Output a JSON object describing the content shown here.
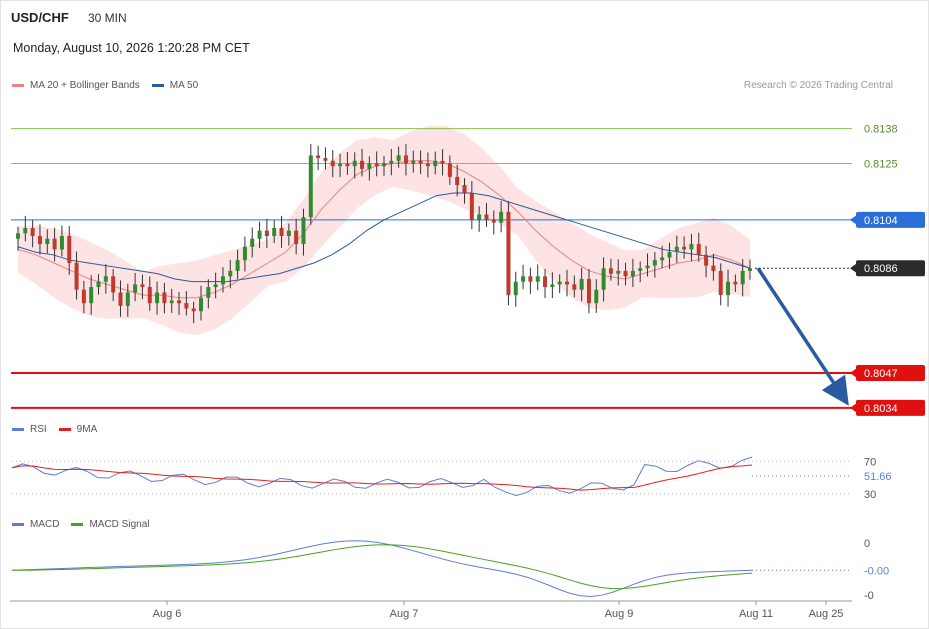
{
  "header": {
    "symbol": "USD/CHF",
    "timeframe": "30 MIN",
    "datetime": "Monday, August 10, 2026 1:20:28 PM CET"
  },
  "credit": "Research © 2026 Trading Central",
  "legends": {
    "main": [
      {
        "label": "MA 20 + Bollinger Bands",
        "color": "#f08080"
      },
      {
        "label": "MA 50",
        "color": "#2c5aa0"
      }
    ],
    "rsi": [
      {
        "label": "RSI",
        "color": "#5b7fd6"
      },
      {
        "label": "9MA",
        "color": "#e02020"
      }
    ],
    "macd": [
      {
        "label": "MACD",
        "color": "#5b7fd6"
      },
      {
        "label": "MACD Signal",
        "color": "#4aa020"
      }
    ]
  },
  "levels": [
    {
      "label": "0.8138",
      "value": 0.8138,
      "kind": "target",
      "color": "#8cc04a"
    },
    {
      "label": "0.8125",
      "value": 0.8125,
      "kind": "target",
      "color": "#8cc04a"
    },
    {
      "label": "0.8104",
      "value": 0.8104,
      "kind": "pivot",
      "color": "#2a6fd8"
    },
    {
      "label": "0.8086",
      "value": 0.8086,
      "kind": "last",
      "color": "#2b2b2b"
    },
    {
      "label": "0.8047",
      "value": 0.8047,
      "kind": "support",
      "color": "#e01010"
    },
    {
      "label": "0.8034",
      "value": 0.8034,
      "kind": "support",
      "color": "#e01010"
    }
  ],
  "x_labels": [
    "Aug 6",
    "Aug 7",
    "Aug 9",
    "Aug 11",
    "Aug 25"
  ],
  "rsi": {
    "ticks": [
      "70",
      "30"
    ],
    "current_label": "51.66",
    "current": 51.66
  },
  "macd": {
    "ticks": [
      "0",
      "-0"
    ],
    "current_label": "-0.00"
  },
  "chart_data": {
    "type": "candlestick",
    "price_range": [
      0.80295,
      0.81505
    ],
    "close_series": [
      0.8099,
      0.8101,
      0.8098,
      0.8095,
      0.8097,
      0.8093,
      0.8098,
      0.8088,
      0.8078,
      0.8073,
      0.8079,
      0.8081,
      0.8083,
      0.8077,
      0.8072,
      0.8077,
      0.808,
      0.8079,
      0.8073,
      0.8077,
      0.8073,
      0.8074,
      0.8073,
      0.8071,
      0.807,
      0.8075,
      0.8079,
      0.808,
      0.8083,
      0.8085,
      0.8089,
      0.8094,
      0.8097,
      0.81,
      0.8098,
      0.8101,
      0.8098,
      0.81,
      0.8095,
      0.8105,
      0.8128,
      0.8127,
      0.8126,
      0.8124,
      0.8125,
      0.8124,
      0.8126,
      0.8123,
      0.8125,
      0.8124,
      0.8125,
      0.8126,
      0.8128,
      0.8125,
      0.8126,
      0.8125,
      0.8124,
      0.8126,
      0.8125,
      0.812,
      0.8117,
      0.8114,
      0.8104,
      0.8106,
      0.8104,
      0.8103,
      0.8107,
      0.8076,
      0.8081,
      0.8083,
      0.8081,
      0.8083,
      0.8079,
      0.808,
      0.8081,
      0.808,
      0.8078,
      0.8082,
      0.8073,
      0.8078,
      0.8086,
      0.8084,
      0.8085,
      0.8083,
      0.8085,
      0.8086,
      0.8087,
      0.8089,
      0.809,
      0.8092,
      0.8094,
      0.8093,
      0.8095,
      0.8091,
      0.8087,
      0.8085,
      0.8076,
      0.8081,
      0.808,
      0.8085,
      0.8086
    ],
    "ma20": [
      0.8093,
      0.8091,
      0.8088,
      0.8085,
      0.8082,
      0.808,
      0.8078,
      0.8076,
      0.8076,
      0.8075,
      0.8075,
      0.8077,
      0.808,
      0.8084,
      0.8088,
      0.8092,
      0.8099,
      0.8108,
      0.8115,
      0.8121,
      0.8124,
      0.8125,
      0.8126,
      0.8126,
      0.8125,
      0.8122,
      0.8118,
      0.8113,
      0.8107,
      0.81,
      0.8094,
      0.8089,
      0.8085,
      0.8083,
      0.8082,
      0.8084,
      0.8086,
      0.8088,
      0.8089,
      0.8091,
      0.8089,
      0.8086
    ],
    "ma50": [
      0.8094,
      0.8092,
      0.8091,
      0.8089,
      0.8088,
      0.8087,
      0.8086,
      0.8085,
      0.8084,
      0.8082,
      0.8081,
      0.8081,
      0.8081,
      0.8082,
      0.8083,
      0.8084,
      0.8086,
      0.8088,
      0.8091,
      0.8095,
      0.81,
      0.8104,
      0.8107,
      0.811,
      0.8113,
      0.8114,
      0.8114,
      0.8113,
      0.8111,
      0.8109,
      0.8107,
      0.8105,
      0.8103,
      0.8101,
      0.8099,
      0.8097,
      0.8095,
      0.8093,
      0.8092,
      0.8091,
      0.809,
      0.8088,
      0.8086
    ],
    "forecast": {
      "from": 0.8086,
      "to": 0.8034,
      "direction": "down"
    }
  }
}
